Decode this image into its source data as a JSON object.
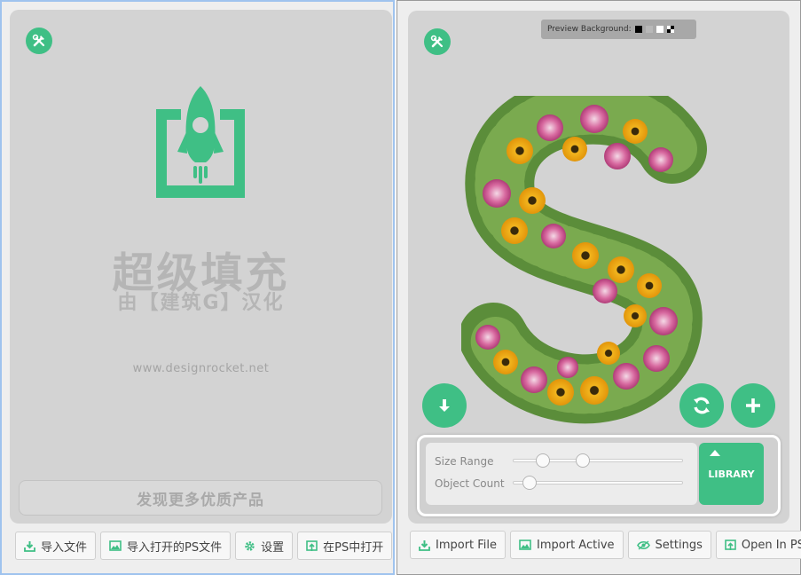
{
  "left_panel": {
    "title_cn": "超级填充",
    "subtitle_cn": "由【建筑G】汉化",
    "website": "www.designrocket.net",
    "discover_button": "发现更多优质产品",
    "buttons": [
      {
        "label": "导入文件",
        "icon": "download-icon"
      },
      {
        "label": "导入打开的PS文件",
        "icon": "image-icon"
      },
      {
        "label": "设置",
        "icon": "gear-icon"
      },
      {
        "label": "在PS中打开",
        "icon": "open-in-icon"
      }
    ]
  },
  "right_panel": {
    "preview_background_label": "Preview Background:",
    "preview_swatches": [
      "black",
      "gray",
      "white",
      "checker"
    ],
    "controls": {
      "size_range_label": "Size Range",
      "object_count_label": "Object Count",
      "size_range_values": [
        0.18,
        0.41
      ],
      "object_count_value": 0.1
    },
    "library_button": "LIBRARY",
    "buttons": [
      {
        "label": "Import File",
        "icon": "download-icon"
      },
      {
        "label": "Import Active",
        "icon": "image-icon"
      },
      {
        "label": "Settings",
        "icon": "eye-icon"
      },
      {
        "label": "Open In PS",
        "icon": "open-in-icon"
      }
    ]
  },
  "colors": {
    "accent": "#3fbf85",
    "panel_bg": "#d3d3d3"
  }
}
